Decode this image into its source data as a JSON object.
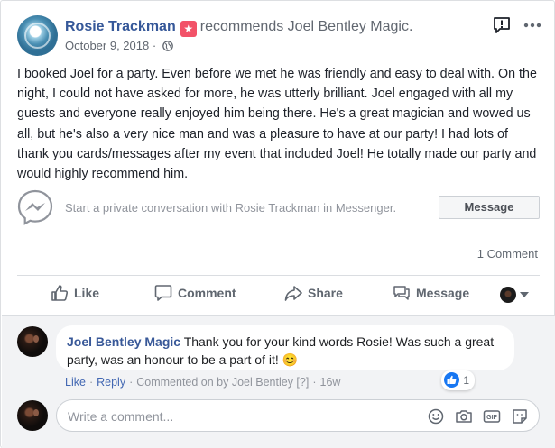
{
  "post": {
    "author": "Rosie Trackman",
    "recommends_text": "recommends",
    "page_name": "Joel Bentley Magic.",
    "date": "October 9, 2018",
    "date_sep": "·",
    "body": "I booked Joel for a party. Even before we met he was friendly and easy to deal with. On the night, I could not have asked for more, he was utterly brilliant. Joel engaged with all my guests and everyone really enjoyed him being there. He's a great magician and wowed us all, but he's also a very nice man and was a pleasure to have at our party! I had lots of thank you cards/messages after my event that included Joel! He totally made our party and would highly recommend him."
  },
  "messenger": {
    "prompt": "Start a private conversation with Rosie Trackman in Messenger.",
    "button": "Message"
  },
  "stats": {
    "comment_count": "1 Comment"
  },
  "actions": {
    "like": "Like",
    "comment": "Comment",
    "share": "Share",
    "message": "Message"
  },
  "comment": {
    "author": "Joel Bentley Magic",
    "text": "Thank you for your kind words Rosie! Was such a great party, was an honour to be a part of it! 😊",
    "reaction_count": "1",
    "like_link": "Like",
    "reply_link": "Reply",
    "commented_on": "Commented on by Joel Bentley [?]",
    "age": "16w",
    "sep": "·"
  },
  "composer": {
    "placeholder": "Write a comment..."
  },
  "colors": {
    "link_blue": "#365899",
    "badge_red": "#f25268",
    "like_blue": "#1877f2"
  },
  "icons": {
    "report": "report-icon",
    "more": "more-icon",
    "globe": "globe-icon",
    "messenger": "messenger-icon",
    "like": "thumbs-up-icon",
    "comment": "comment-icon",
    "share": "share-icon",
    "message": "message-icon",
    "emoji": "emoji-icon",
    "camera": "camera-icon",
    "gif": "gif-icon",
    "sticker": "sticker-icon"
  }
}
